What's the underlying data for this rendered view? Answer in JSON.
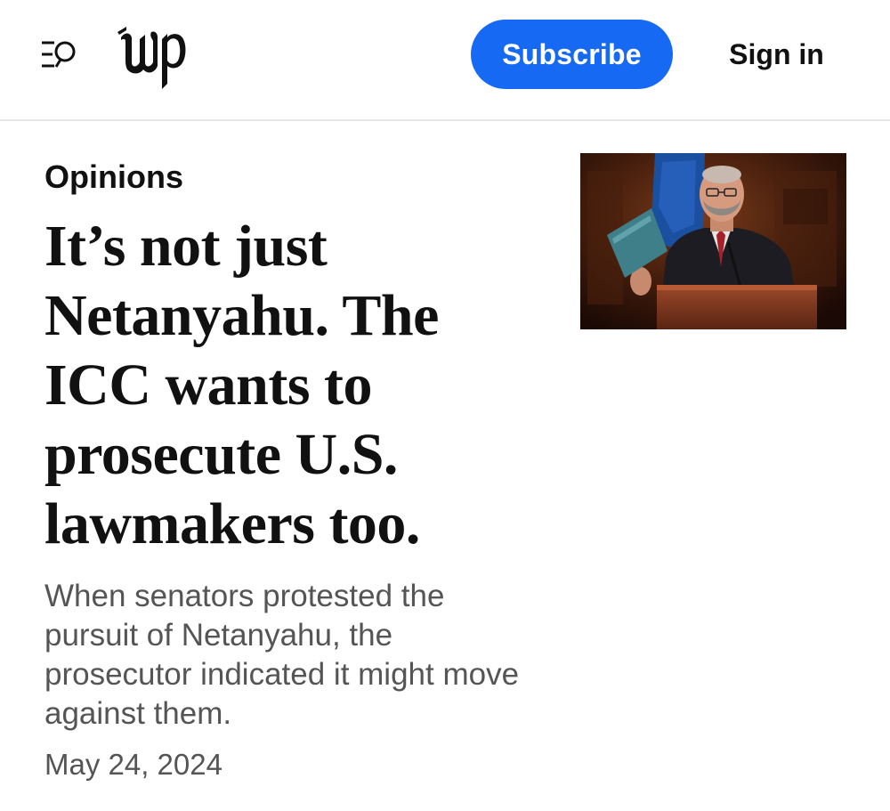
{
  "header": {
    "menu_icon": "menu-search-icon",
    "logo_icon": "washington-post-wp-logo",
    "subscribe_label": "Subscribe",
    "signin_label": "Sign in",
    "brand_color": "#1669f2"
  },
  "article": {
    "section": "Opinions",
    "headline": "It’s not just Netanyahu. The ICC wants to prosecute U.S. lawmakers too.",
    "dek": "When senators protested the pursuit of Netanyahu, the prosecutor indicated it might move against them.",
    "date": "May 24, 2024",
    "photo_icon": "speaker-at-podium-photo"
  }
}
